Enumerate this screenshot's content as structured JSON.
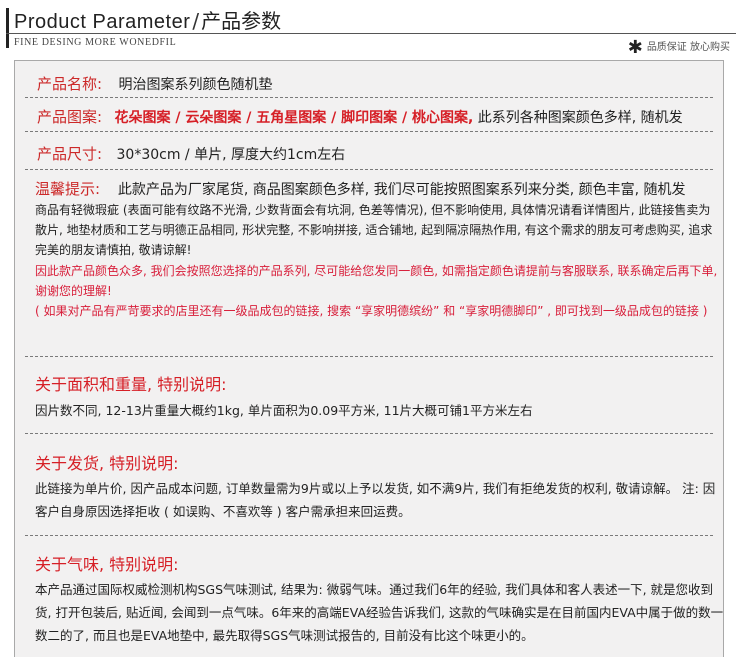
{
  "header": {
    "title_en": "Product Parameter",
    "title_slash": "/",
    "title_cn": "产品参数",
    "subtitle": "FINE DESING MORE WONEDFIL",
    "tagline": "品质保证 放心购买"
  },
  "params": {
    "name_label": "产品名称:",
    "name_value": "明治图案系列颜色随机垫",
    "pattern_label": "产品图案:",
    "pattern_values": "花朵图案 / 云朵图案 / 五角星图案 /  脚印图案 / 桃心图案,",
    "pattern_note": "此系列各种图案颜色多样, 随机发",
    "size_label": "产品尺寸:",
    "size_value": "30*30cm / 单片, 厚度大约1cm左右"
  },
  "tips": {
    "label": "温馨提示:",
    "lead": "此款产品为厂家尾货, 商品图案颜色多样, 我们尽可能按照图案系列来分类, 颜色丰富, 随机发",
    "body": "商品有轻微瑕疵 (表面可能有纹路不光滑, 少数背面会有坑洞, 色差等情况), 但不影响使用, 具体情况请看详情图片, 此链接售卖为散片, 地垫材质和工艺与明德正品相同, 形状完整, 不影响拼接, 适合铺地, 起到隔凉隔热作用, 有这个需求的朋友可考虑购买, 追求完美的朋友请慎拍, 敬请谅解!",
    "note1": "因此款产品颜色众多, 我们会按照您选择的产品系列, 尽可能给您发同一颜色, 如需指定颜色请提前与客服联系, 联系确定后再下单, 谢谢您的理解!",
    "note2": "( 如果对产品有严苛要求的店里还有一级品成包的链接, 搜索 “享家明德缤纷” 和 “享家明德脚印” , 即可找到一级品成包的链接 )"
  },
  "sections": {
    "area": {
      "title": "关于面积和重量, 特别说明:",
      "body": "因片数不同, 12-13片重量大概约1kg, 单片面积为0.09平方米, 11片大概可铺1平方米左右"
    },
    "shipping": {
      "title": "关于发货, 特别说明:",
      "body": "此链接为单片价, 因产品成本问题, 订单数量需为9片或以上予以发货, 如不满9片, 我们有拒绝发货的权利, 敬请谅解。 注: 因客户自身原因选择拒收 ( 如误购、不喜欢等 ) 客户需承担来回运费。"
    },
    "smell": {
      "title": "关于气味, 特别说明:",
      "body": "本产品通过国际权威检测机构SGS气味测试, 结果为: 微弱气味。通过我们6年的经验, 我们具体和客人表述一下, 就是您收到货, 打开包装后, 贴近闻, 会闻到一点气味。6年来的高端EVA经验告诉我们, 这款的气味确实是在目前国内EVA中属于做的数一数二的了, 而且也是EVA地垫中, 最先取得SGS气味测试报告的, 目前没有比这个味更小的。"
    }
  }
}
